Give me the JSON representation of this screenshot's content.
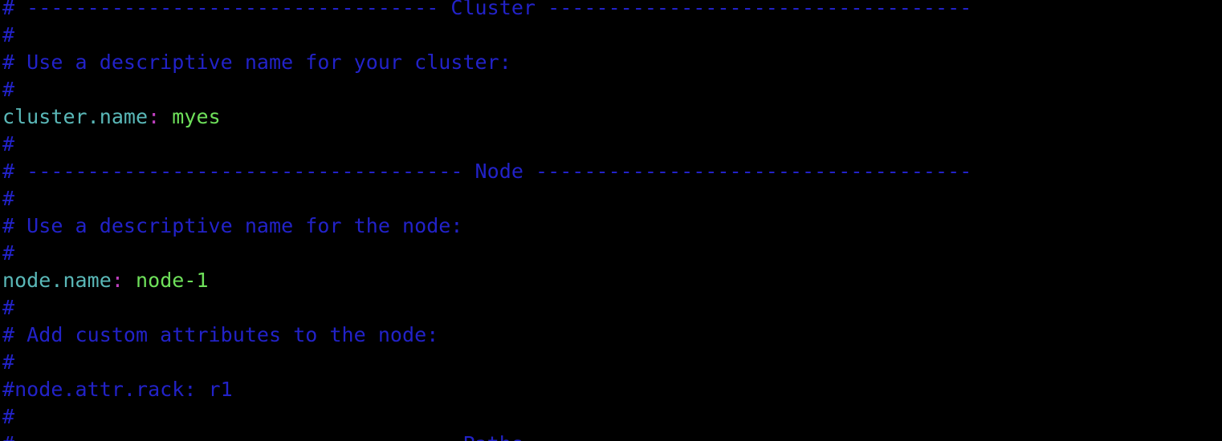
{
  "editor": {
    "colors": {
      "background": "#000000",
      "comment": "#2222c8",
      "key": "#5ab8b8",
      "colon": "#c040c0",
      "value": "#6ee05a"
    },
    "lines": [
      {
        "type": "comment",
        "text": "# ---------------------------------- Cluster -----------------------------------"
      },
      {
        "type": "comment",
        "text": "#"
      },
      {
        "type": "comment",
        "text": "# Use a descriptive name for your cluster:"
      },
      {
        "type": "comment",
        "text": "#"
      },
      {
        "type": "setting",
        "key": "cluster.name",
        "colon": ":",
        "value": " myes"
      },
      {
        "type": "comment",
        "text": "#"
      },
      {
        "type": "comment",
        "text": "# ------------------------------------ Node ------------------------------------"
      },
      {
        "type": "comment",
        "text": "#"
      },
      {
        "type": "comment",
        "text": "# Use a descriptive name for the node:"
      },
      {
        "type": "comment",
        "text": "#"
      },
      {
        "type": "setting",
        "key": "node.name",
        "colon": ":",
        "value": " node-1"
      },
      {
        "type": "comment",
        "text": "#"
      },
      {
        "type": "comment",
        "text": "# Add custom attributes to the node:"
      },
      {
        "type": "comment",
        "text": "#"
      },
      {
        "type": "comment",
        "text": "#node.attr.rack: r1"
      },
      {
        "type": "comment",
        "text": "#"
      },
      {
        "type": "comment",
        "text": "# ----------------------------------- Paths ------------------------------------"
      }
    ]
  }
}
